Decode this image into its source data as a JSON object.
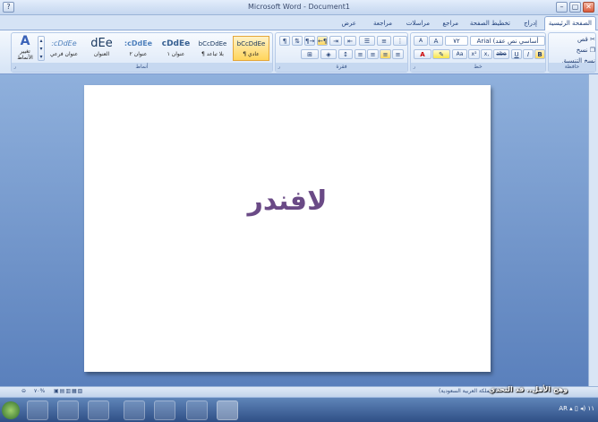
{
  "window": {
    "title": "Microsoft Word - Document1"
  },
  "tabs": [
    "الصفحة الرئيسية",
    "إدراج",
    "تخطيط الصفحة",
    "مراجع",
    "مراسلات",
    "مراجعة",
    "عرض"
  ],
  "ribbon": {
    "clipboard": {
      "label": "حافظة",
      "paste": "لصق",
      "cut": "قص",
      "copy": "نسخ",
      "format_painter": "نسخ التنسيق"
    },
    "font": {
      "label": "خط",
      "font_name": "Arial (أساسي نص عقد",
      "font_size": "٧٢",
      "bold": "B",
      "italic": "I",
      "underline": "U",
      "strike": "abe",
      "sub": "x,",
      "sup": "x²",
      "change_case": "Aa",
      "grow": "A",
      "shrink": "A"
    },
    "paragraph": {
      "label": "فقرة"
    },
    "styles": {
      "label": "أنماط",
      "items": [
        {
          "sample": "bCcDdEe",
          "name": "¶ عادي"
        },
        {
          "sample": "bCcDdEe",
          "name": "¶ بلا تباعد"
        },
        {
          "sample": "cDdEe",
          "name": "عنوان ١"
        },
        {
          "sample": ":cDdEe",
          "name": "عنوان ٢"
        },
        {
          "sample": "dEe",
          "name": "العنوان"
        },
        {
          "sample": ":cDdEe",
          "name": "عنوان فرعي"
        }
      ],
      "change_styles": "تغيير الأنماط"
    }
  },
  "document": {
    "text": "لافندر"
  },
  "statusbar": {
    "zoom": "٧٠%",
    "language": "(المملكة العربية السعودية)"
  },
  "caption": "وهج الأمل.. قد التحدي",
  "taskbar": {
    "lang": "AR",
    "time": "١١"
  },
  "colors": {
    "title_bar": "#c4d6ef",
    "workspace": "#6a8fc5",
    "doc_text": "#6a4a86",
    "taskbar": "#2f4f86"
  }
}
